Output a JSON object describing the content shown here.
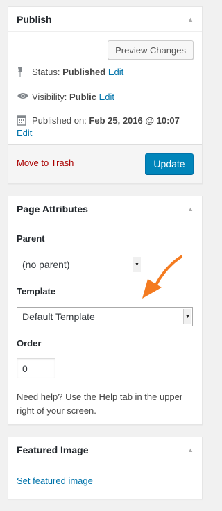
{
  "publish": {
    "title": "Publish",
    "toggle_icon": "triangle-up-icon",
    "preview_label": "Preview Changes",
    "status_label": "Status:",
    "status_value": "Published",
    "status_edit": "Edit",
    "visibility_label": "Visibility:",
    "visibility_value": "Public",
    "visibility_edit": "Edit",
    "published_label": "Published on:",
    "published_value": "Feb 25, 2016 @ 10:07",
    "published_edit": "Edit",
    "trash_label": "Move to Trash",
    "update_label": "Update"
  },
  "attributes": {
    "title": "Page Attributes",
    "parent_label": "Parent",
    "parent_value": "(no parent)",
    "template_label": "Template",
    "template_value": "Default Template",
    "order_label": "Order",
    "order_value": "0",
    "help_text": "Need help? Use the Help tab in the upper right of your screen."
  },
  "featured": {
    "title": "Featured Image",
    "link_label": "Set featured image"
  },
  "colors": {
    "accent": "#0085ba",
    "link": "#0073aa",
    "danger": "#a00",
    "annotation_arrow": "#f47b20"
  }
}
